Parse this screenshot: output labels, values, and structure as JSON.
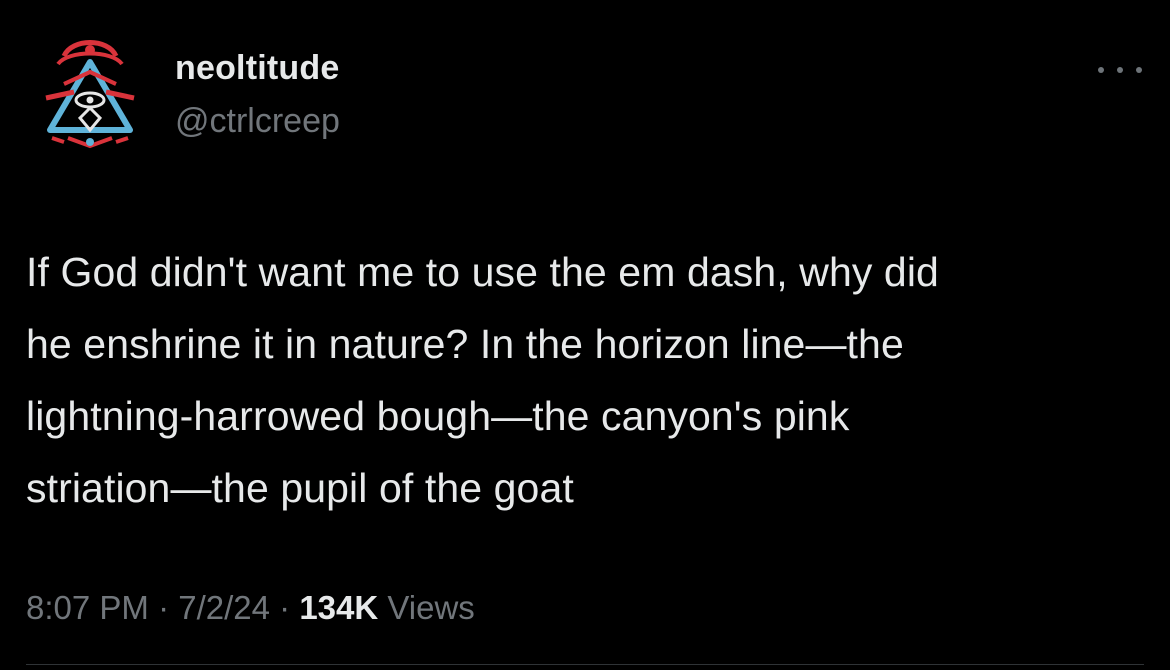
{
  "author": {
    "display_name": "neoltitude",
    "handle": "@ctrlcreep",
    "avatar_icon": "pyramid-eye-icon"
  },
  "menu": {
    "more_icon": "more-horizontal-icon"
  },
  "tweet": {
    "text": "If God didn't want me to use the em dash, why did\nhe enshrine it in nature? In the horizon line—the\nlightning-harrowed bough—the canyon's pink\nstriation—the pupil of the goat"
  },
  "meta": {
    "time": "8:07 PM",
    "separator": " · ",
    "date": "7/2/24",
    "views_count": "134K",
    "views_label": " Views"
  },
  "colors": {
    "background": "#000000",
    "primary_text": "#e7e9ea",
    "secondary_text": "#71767b",
    "avatar_red": "#d9333b",
    "avatar_blue": "#5fb3d9"
  }
}
